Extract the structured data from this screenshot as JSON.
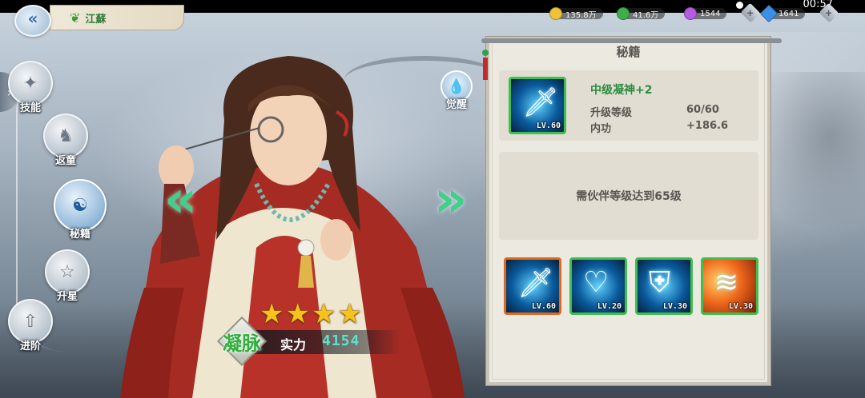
{
  "status_bar": {
    "signal": "...",
    "time": "00:57"
  },
  "header": {
    "back_icon": "back-arrow-icon",
    "character_name": "江蘇",
    "name_icon": "leaf-icon"
  },
  "resources": [
    {
      "name": "gold",
      "value": "135.8万",
      "color": "#f0c23a"
    },
    {
      "name": "jade",
      "value": "41.6万",
      "color": "#3fae4a"
    },
    {
      "name": "spirit",
      "value": "1544",
      "color": "#b45de0"
    },
    {
      "name": "diamond",
      "value": "1641",
      "color": "#3d8fe6"
    }
  ],
  "sidenav": {
    "items": [
      {
        "label": "技能",
        "icon": "skill-icon"
      },
      {
        "label": "返童",
        "icon": "rocking-horse-icon"
      },
      {
        "label": "秘籍",
        "icon": "yin-yang-icon",
        "active": true
      },
      {
        "label": "升星",
        "icon": "star-icon"
      },
      {
        "label": "进阶",
        "icon": "advance-icon"
      }
    ]
  },
  "awaken": {
    "label": "觉醒",
    "icon": "water-drop-icon"
  },
  "character": {
    "stars": 4,
    "realm": "凝脉",
    "power_label": "实力",
    "power_value": "4154"
  },
  "panel": {
    "title": "秘籍",
    "selected": {
      "name": "中级凝神+2",
      "icon": "sword-icon",
      "level": "LV.60",
      "stats": [
        {
          "label": "升级等级",
          "value": "60/60"
        },
        {
          "label": "内功",
          "value": "+186.6"
        }
      ]
    },
    "requirement": "需伙伴等级达到65级",
    "slots": [
      {
        "icon": "sword-icon",
        "level": "LV.60",
        "selected": true,
        "style": "blue"
      },
      {
        "icon": "heart-plus-icon",
        "level": "LV.20",
        "selected": false,
        "style": "blue"
      },
      {
        "icon": "shield-sword-icon",
        "level": "LV.30",
        "selected": false,
        "style": "blue"
      },
      {
        "icon": "slash-icon",
        "level": "LV.30",
        "selected": false,
        "style": "orange"
      }
    ]
  }
}
